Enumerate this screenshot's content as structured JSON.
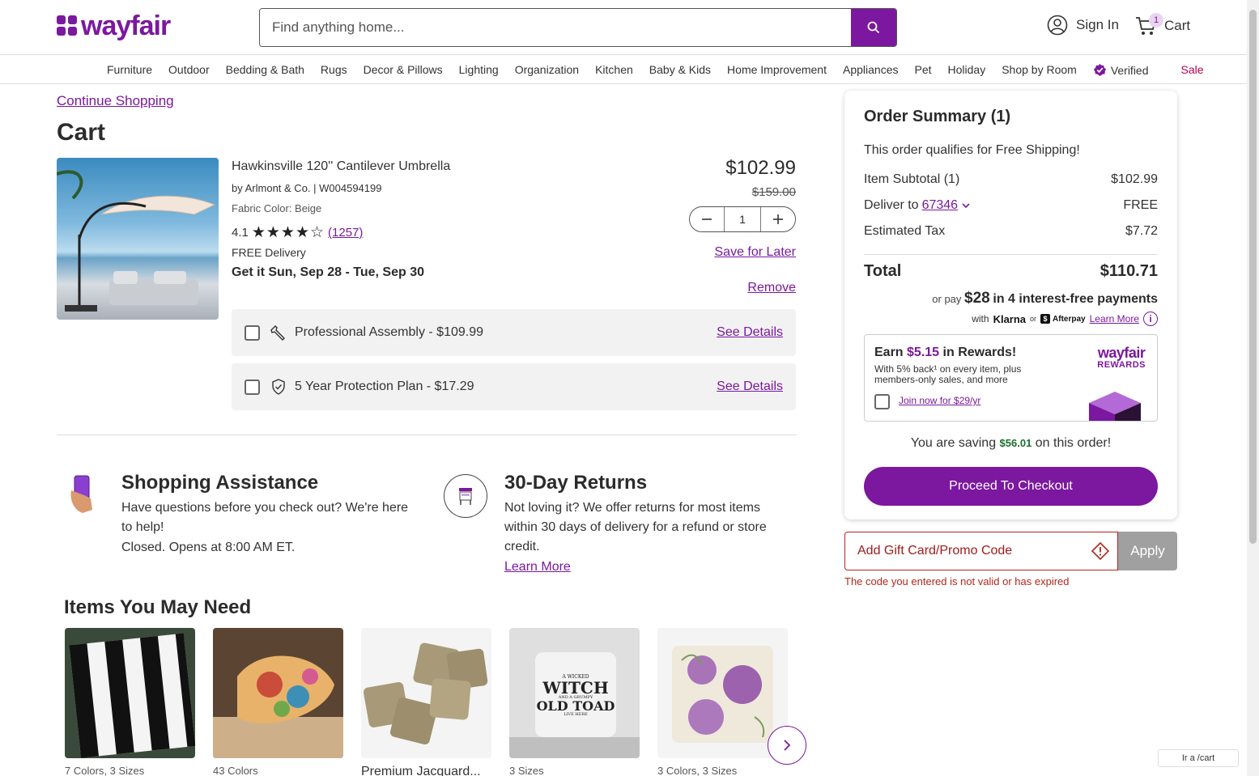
{
  "header": {
    "logo_text": "wayfair",
    "search_placeholder": "Find anything home...",
    "sign_in": "Sign In",
    "cart_label": "Cart",
    "cart_count": "1"
  },
  "nav": {
    "items": [
      "Furniture",
      "Outdoor",
      "Bedding & Bath",
      "Rugs",
      "Decor & Pillows",
      "Lighting",
      "Organization",
      "Kitchen",
      "Baby & Kids",
      "Home Improvement",
      "Appliances",
      "Pet",
      "Holiday",
      "Shop by Room"
    ],
    "verified": "Verified",
    "sale": "Sale"
  },
  "cart": {
    "continue_shopping": "Continue Shopping",
    "title": "Cart",
    "product": {
      "name": "Hawkinsville 120'' Cantilever Umbrella",
      "by": "by Arlmont & Co. | W004594199",
      "fabric": "Fabric Color: Beige",
      "rating": "4.1",
      "rating_value": 4.1,
      "stars": "★★★★☆",
      "reviews": "(1257)",
      "delivery": "FREE Delivery",
      "delivery_date": "Get it Sun, Sep 28 - Tue, Sep 30",
      "price": "$102.99",
      "old_price": "$159.00",
      "quantity": "1",
      "save_for_later": "Save for Later",
      "remove": "Remove"
    },
    "addons": [
      {
        "label": "Professional Assembly - $109.99",
        "link": "See Details"
      },
      {
        "label": "5 Year Protection Plan - $17.29",
        "link": "See Details"
      }
    ]
  },
  "assistance": {
    "title": "Shopping Assistance",
    "body": "Have questions before you check out? We're here to help!",
    "hours": "Closed. Opens at 8:00 AM ET."
  },
  "returns": {
    "title": "30-Day Returns",
    "body": "Not loving it? We offer returns for most items within 30 days of delivery for a refund or store credit.",
    "learn_more": "Learn More"
  },
  "recommendations": {
    "title": "Items You May Need",
    "items": [
      {
        "meta": "7 Colors, 3 Sizes"
      },
      {
        "meta": "43 Colors"
      },
      {
        "meta": "Premium Jacquard..."
      },
      {
        "meta": "3 Sizes",
        "img_text_1": "A WICKED",
        "img_text_2": "WITCH",
        "img_text_3": "AND A GRUMPY",
        "img_text_4": "OLD TOAD",
        "img_text_5": "LIVE HERE"
      },
      {
        "meta": "3 Colors, 3 Sizes"
      }
    ]
  },
  "summary": {
    "title": "Order Summary (1)",
    "free_shipping": "This order qualifies for Free Shipping!",
    "subtotal_label": "Item Subtotal (1)",
    "subtotal": "$102.99",
    "deliver_label": "Deliver to",
    "zip": "67346",
    "deliver_value": "FREE",
    "tax_label": "Estimated Tax",
    "tax": "$7.72",
    "total_label": "Total",
    "total": "$110.71",
    "pay_prefix": "or pay",
    "pay_amount": "$28",
    "pay_suffix": "in 4 interest-free payments",
    "pay_with": "with",
    "klarna": "Klarna",
    "or": "or",
    "afterpay": "Afterpay",
    "learn_more": "Learn More",
    "rewards_earn": "Earn",
    "rewards_amount": "$5.15",
    "rewards_suffix": "in Rewards!",
    "rewards_body": "With 5% back¹ on every item, plus members-only sales, and more",
    "rewards_join": "Join now for $29/yr",
    "rewards_logo": "wayfair",
    "rewards_logo_sub": "REWARDS",
    "saving_prefix": "You are saving",
    "saving_amount": "$56.01",
    "saving_suffix": "on this order!",
    "checkout": "Proceed To Checkout"
  },
  "promo": {
    "placeholder": "Add Gift Card/Promo Code",
    "apply": "Apply",
    "error": "The code you entered is not valid or has expired"
  },
  "status_url": "Ir a /cart",
  "colors": {
    "brand": "#7b189f",
    "error": "#b3261e",
    "saving": "#1b6e2e"
  }
}
